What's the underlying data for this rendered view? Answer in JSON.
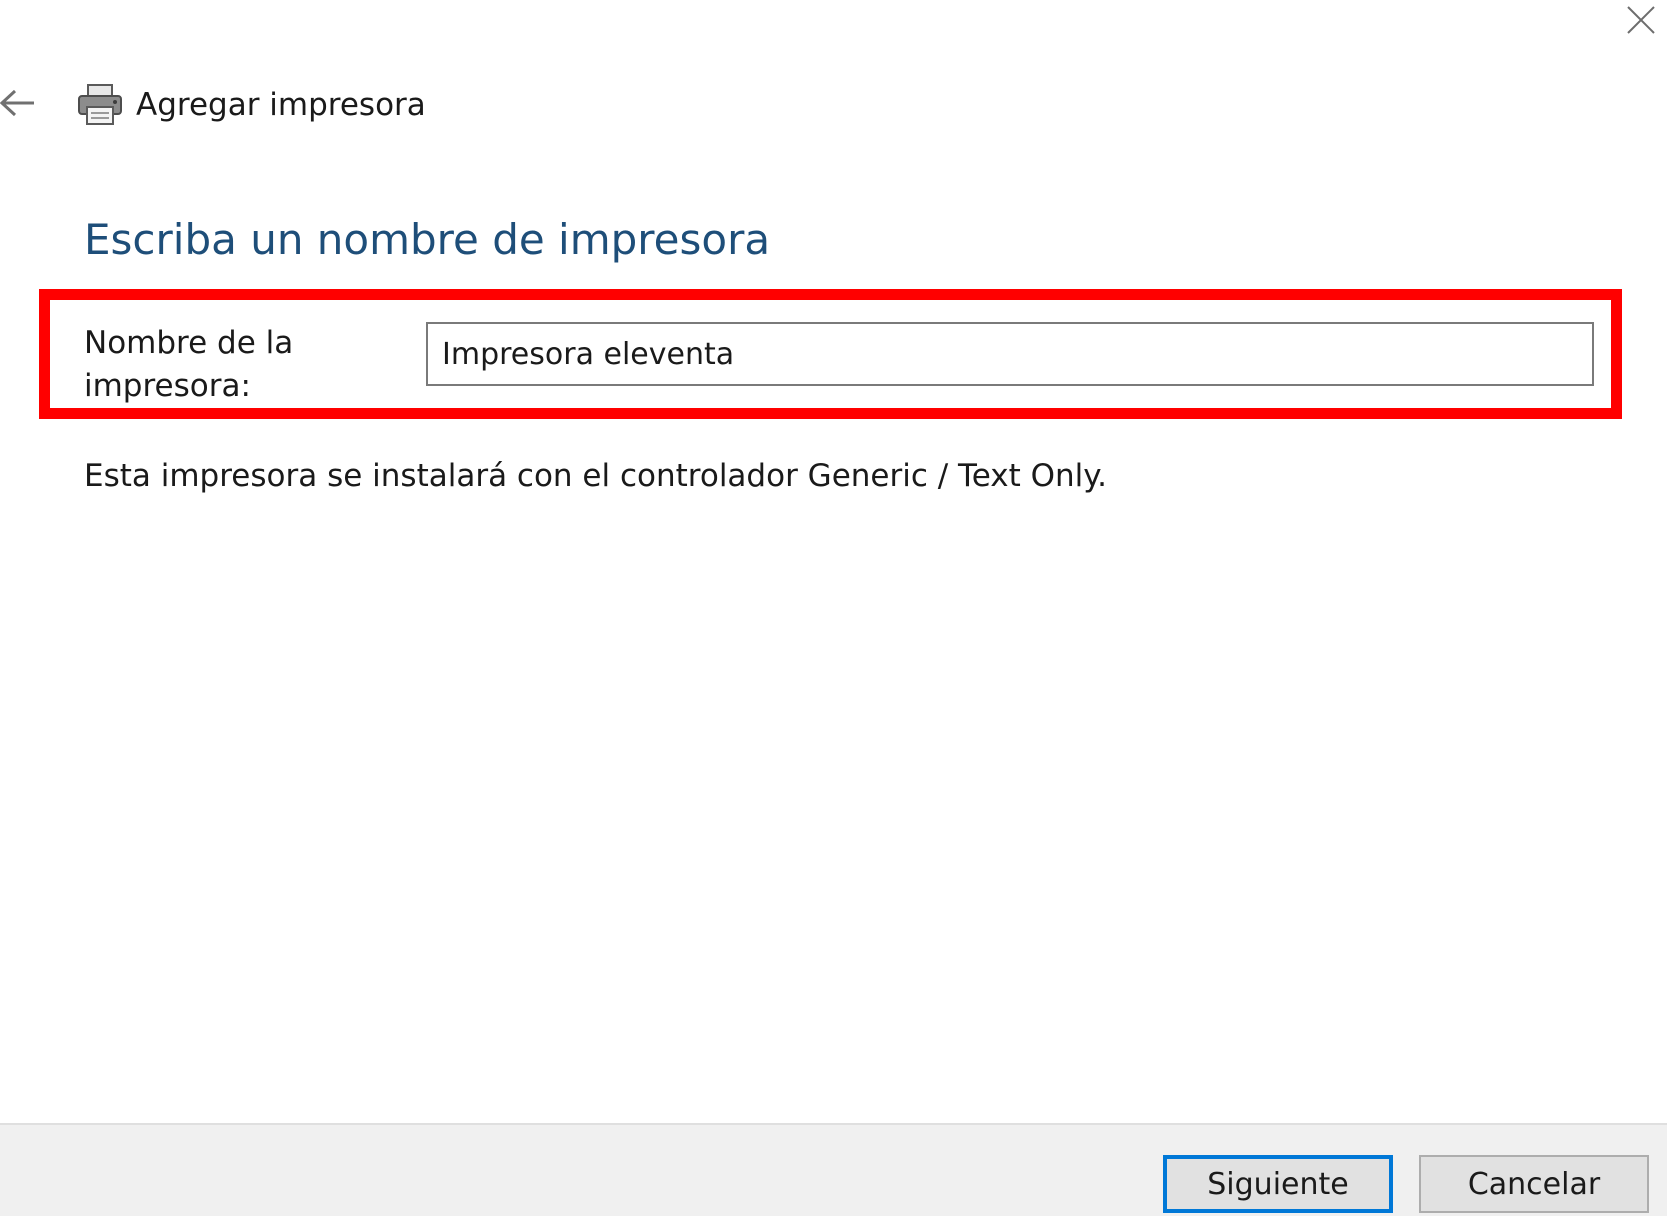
{
  "window": {
    "close_icon": "close-icon"
  },
  "header": {
    "back_icon": "back-arrow-icon",
    "printer_icon": "printer-icon",
    "title": "Agregar impresora"
  },
  "main": {
    "page_title": "Escriba un nombre de impresora",
    "printer_name_label": "Nombre de la impresora:",
    "printer_name_value": "Impresora eleventa",
    "driver_info": "Esta impresora se instalará con el controlador Generic / Text Only.",
    "highlight_color": "#ff0000",
    "title_color": "#1e4e79"
  },
  "footer": {
    "next_label": "Siguiente",
    "cancel_label": "Cancelar",
    "accent_color": "#0078d7"
  }
}
